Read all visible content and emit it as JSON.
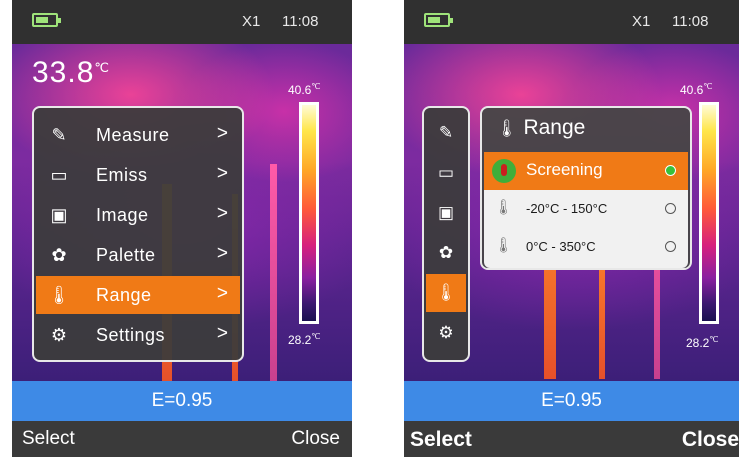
{
  "status_bar": {
    "zoom": "X1",
    "time": "11:08"
  },
  "left_screen": {
    "spot_temp": {
      "value": "33.8",
      "unit": "℃"
    },
    "scale": {
      "max_value": "40.6",
      "min_value": "28.2",
      "unit": "℃"
    },
    "menu": {
      "items": [
        {
          "label": "Measure",
          "icon": "measure-icon",
          "arrow": ">"
        },
        {
          "label": "Emiss",
          "icon": "ruler-icon",
          "arrow": ">"
        },
        {
          "label": "Image",
          "icon": "image-icon",
          "arrow": ">"
        },
        {
          "label": "Palette",
          "icon": "palette-icon",
          "arrow": ">"
        },
        {
          "label": "Range",
          "icon": "thermometer-range-icon",
          "arrow": ">",
          "selected": true
        },
        {
          "label": "Settings",
          "icon": "gear-icon",
          "arrow": ">"
        }
      ]
    },
    "emissivity": "E=0.95",
    "softkeys": {
      "left": "Select",
      "right": "Close"
    }
  },
  "right_screen": {
    "scale": {
      "max_value": "40.6",
      "min_value": "28.2",
      "unit": "℃"
    },
    "icon_column": [
      "measure-icon",
      "ruler-icon",
      "image-icon",
      "palette-icon",
      "thermometer-range-icon",
      "gear-icon"
    ],
    "range_panel": {
      "title": "Range",
      "options": [
        {
          "label": "Screening",
          "selected": true
        },
        {
          "label": "-20°C - 150°C",
          "selected": false
        },
        {
          "label": "0°C - 350°C",
          "selected": false
        }
      ]
    },
    "emissivity": "E=0.95",
    "softkeys": {
      "left": "Select",
      "right": "Close"
    }
  },
  "colors": {
    "accent_orange": "#f07a16",
    "emissivity_bar_blue": "#3e8ae6",
    "battery_green": "#9fe37a"
  }
}
